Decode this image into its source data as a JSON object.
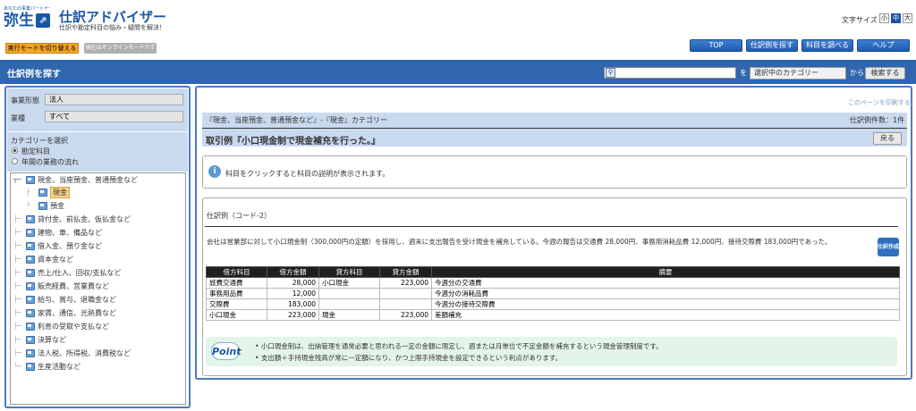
{
  "header": {
    "logo_tagline": "あなたの事業パートナー 弥生",
    "logo_name": "弥生",
    "logo_mark": "⇗",
    "title": "仕訳アドバイザー",
    "subtitle": "仕訳や勘定科目の悩み・疑問を解決！",
    "font_size_label": "文字サイズ",
    "font_sizes": [
      "小",
      "中",
      "大"
    ],
    "mode_button": "実行モードを切り替える",
    "mode_badge": "現在はオンラインモードです",
    "nav": [
      "TOP",
      "仕訳例を探す",
      "科目を調べる",
      "ヘルプ"
    ]
  },
  "search_bar": {
    "title": "仕訳例を探す",
    "input_value": "",
    "wo": "を",
    "category_select": "選択中のカテゴリー",
    "kara": "から",
    "search_button": "検索する"
  },
  "left": {
    "business_type_label": "事業形態",
    "business_type_value": "法人",
    "industry_label": "業種",
    "industry_value": "すべて",
    "category_label": "カテゴリーを選択",
    "radio_account": "勘定科目",
    "radio_flow": "年間の業務の流れ",
    "tree": [
      "現金、当座預金、普通預金など",
      "現金",
      "預金",
      "貸付金、前払金、仮払金など",
      "建物、車、備品など",
      "借入金、預り金など",
      "資本金など",
      "売上/仕入、回収/支払など",
      "販売経費、営業費など",
      "給与、賞与、退職金など",
      "家賃、通信、光熱費など",
      "利息の受取や支払など",
      "決算など",
      "法人税、所得税、消費税など",
      "生産活動など"
    ]
  },
  "main": {
    "print_link": "このページを印刷する。",
    "category_path": "『現金、当座預金、普通預金など』-『現金』カテゴリー",
    "count": "仕訳例件数：1件",
    "example_title": "取引例『小口現金制で現金補充を行った。』",
    "back_button": "戻る",
    "info_icon": "i",
    "info_text": "科目をクリックすると科目の説明が表示されます。",
    "code_label": "仕訳例（コード-2）",
    "description": "会社は営業部に対して小口現金制（300,000円の定額）を採用し、週末に支出報告を受け現金を補充している。今週の報告は交通費 28,000円、事務用消耗品費 12,000円、接待交際費 183,000円であった。",
    "shiwake_icon_label": "仕訳作成",
    "table_headers": [
      "借方科目",
      "借方金額",
      "貸方科目",
      "貸方金額",
      "摘要"
    ],
    "table_rows": [
      [
        "旅費交通費",
        "28,000",
        "小口現金",
        "223,000",
        "今週分の交通費"
      ],
      [
        "事務用品費",
        "12,000",
        "",
        "",
        "今週分の消耗品費"
      ],
      [
        "交際費",
        "183,000",
        "",
        "",
        "今週分の接待交際費"
      ],
      [
        "小口現金",
        "223,000",
        "現金",
        "223,000",
        "差額補充"
      ]
    ],
    "point_label": "Point",
    "point_notes": [
      "小口現金制は、出納管理を通常必要と思われる一定の金額に限定し、週または月単位で不足金額を補充するという現金管理制度です。",
      "支出額＋手持現金残高が常に一定額になり、かつ上限手持現金を設定できるという利点があります。"
    ]
  },
  "colors": {
    "brand_blue": "#1a56a6",
    "bar_blue": "#2f66ad",
    "panel_blue": "#c9d9ee",
    "mode_orange": "#f5a623",
    "point_green": "#e3f4ea"
  }
}
